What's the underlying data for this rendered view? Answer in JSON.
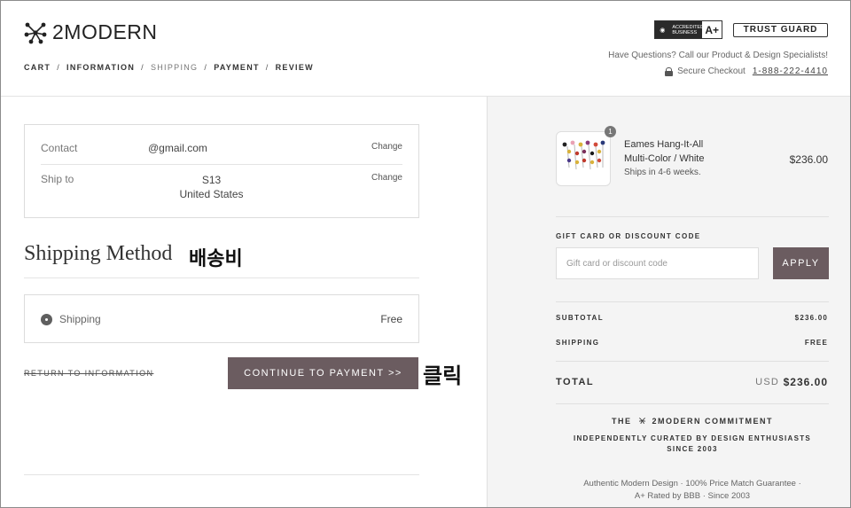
{
  "header": {
    "logo_text": "2MODERN",
    "breadcrumb": [
      {
        "label": "CART",
        "active": false
      },
      {
        "label": "INFORMATION",
        "active": false
      },
      {
        "label": "SHIPPING",
        "active": true
      },
      {
        "label": "PAYMENT",
        "active": false
      },
      {
        "label": "REVIEW",
        "active": false
      }
    ],
    "breadcrumb_sep": "/",
    "bbb_line1": "ACCREDITED",
    "bbb_line2": "BUSINESS",
    "bbb_grade": "A+",
    "trust_badge": "TRUST GUARD",
    "help_text": "Have Questions? Call our Product & Design Specialists!",
    "secure_label": "Secure Checkout",
    "phone": "1-888-222-4410"
  },
  "contact": {
    "label": "Contact",
    "value": "@gmail.com",
    "change": "Change"
  },
  "ship_to": {
    "label": "Ship to",
    "line1": "S13",
    "line2": "United States",
    "change": "Change"
  },
  "shipping_method": {
    "title": "Shipping Method",
    "annotation": "배송비",
    "option_label": "Shipping",
    "option_price": "Free"
  },
  "actions": {
    "return_link": "RETURN TO INFORMATION",
    "continue_button": "CONTINUE TO PAYMENT >>",
    "annotation": "클릭"
  },
  "order": {
    "quantity": "1",
    "product_name_line1": "Eames Hang-It-All",
    "product_name_line2": "Multi-Color / White",
    "ships_text": "Ships in 4-6 weeks.",
    "price": "$236.00"
  },
  "gift": {
    "label": "GIFT CARD OR DISCOUNT CODE",
    "placeholder": "Gift card or discount code",
    "apply_label": "APPLY"
  },
  "summary": {
    "subtotal_label": "SUBTOTAL",
    "subtotal_value": "$236.00",
    "shipping_label": "SHIPPING",
    "shipping_value": "FREE",
    "total_label": "TOTAL",
    "currency": "USD",
    "total_value": "$236.00"
  },
  "commitment": {
    "title_pre": "THE",
    "title_post": "2MODERN COMMITMENT",
    "subtitle_line1": "INDEPENDENTLY CURATED BY DESIGN ENTHUSIASTS",
    "subtitle_line2": "SINCE 2003",
    "footer_line1": "Authentic Modern Design · 100% Price Match Guarantee ·",
    "footer_line2": "A+ Rated by BBB · Since 2003"
  },
  "colors": {
    "accent_button": "#6b5c60",
    "sidebar_bg": "#f4f4f4"
  }
}
